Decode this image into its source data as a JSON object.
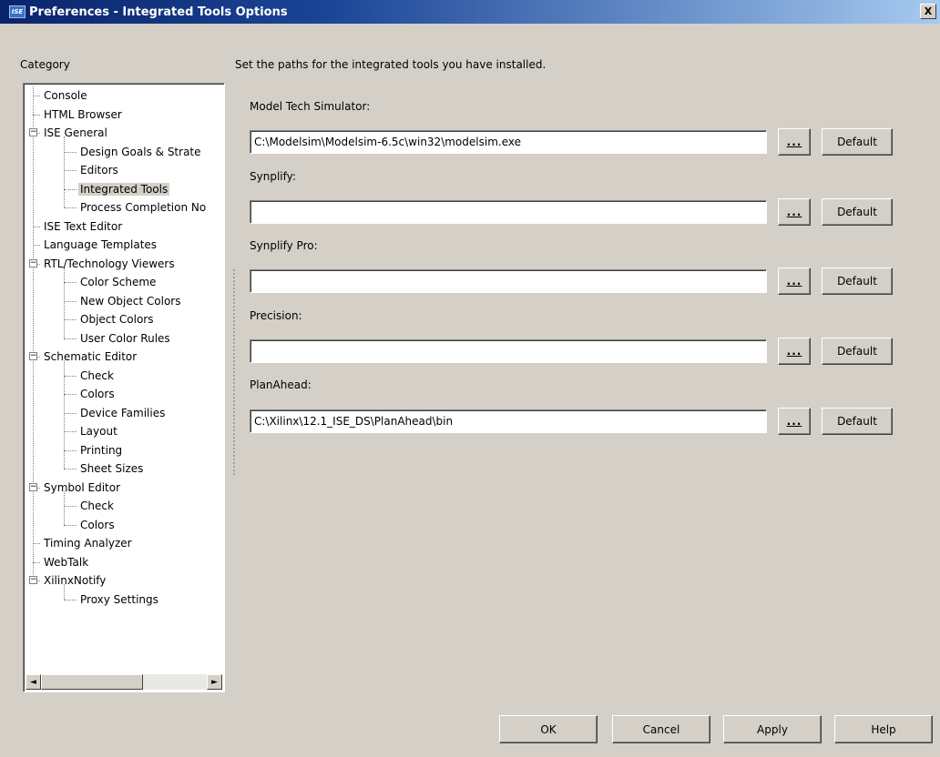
{
  "window": {
    "title": "Preferences - Integrated Tools Options",
    "icon_text": "ISE",
    "close_label": "X"
  },
  "category_label": "Category",
  "tree": {
    "items": [
      {
        "label": "Console",
        "level": 1
      },
      {
        "label": "HTML Browser",
        "level": 1
      },
      {
        "label": "ISE General",
        "level": 1,
        "expander": "−"
      },
      {
        "label": "Design Goals & Strate",
        "level": 2
      },
      {
        "label": "Editors",
        "level": 2
      },
      {
        "label": "Integrated Tools",
        "level": 2,
        "selected": true
      },
      {
        "label": "Process Completion No",
        "level": 2
      },
      {
        "label": "ISE Text Editor",
        "level": 1
      },
      {
        "label": "Language Templates",
        "level": 1
      },
      {
        "label": "RTL/Technology Viewers",
        "level": 1,
        "expander": "−"
      },
      {
        "label": "Color Scheme",
        "level": 2
      },
      {
        "label": "New Object Colors",
        "level": 2
      },
      {
        "label": "Object Colors",
        "level": 2
      },
      {
        "label": "User Color Rules",
        "level": 2
      },
      {
        "label": "Schematic Editor",
        "level": 1,
        "expander": "−"
      },
      {
        "label": "Check",
        "level": 2
      },
      {
        "label": "Colors",
        "level": 2
      },
      {
        "label": "Device Families",
        "level": 2
      },
      {
        "label": "Layout",
        "level": 2
      },
      {
        "label": "Printing",
        "level": 2
      },
      {
        "label": "Sheet Sizes",
        "level": 2
      },
      {
        "label": "Symbol Editor",
        "level": 1,
        "expander": "−"
      },
      {
        "label": "Check",
        "level": 2
      },
      {
        "label": "Colors",
        "level": 2
      },
      {
        "label": "Timing Analyzer",
        "level": 1
      },
      {
        "label": "WebTalk",
        "level": 1
      },
      {
        "label": "XilinxNotify",
        "level": 1,
        "expander": "−"
      },
      {
        "label": "Proxy Settings",
        "level": 2
      }
    ],
    "scroll_left": "◄",
    "scroll_right": "►"
  },
  "description": "Set the paths for the integrated tools you have installed.",
  "tools": [
    {
      "label": "Model Tech Simulator:",
      "value": "C:\\Modelsim\\Modelsim-6.5c\\win32\\modelsim.exe",
      "browse_label": "...",
      "default_label": "Default"
    },
    {
      "label": "Synplify:",
      "value": "",
      "browse_label": "...",
      "default_label": "Default"
    },
    {
      "label": "Synplify Pro:",
      "value": "",
      "browse_label": "...",
      "default_label": "Default"
    },
    {
      "label": "Precision:",
      "value": "",
      "browse_label": "...",
      "default_label": "Default"
    },
    {
      "label": "PlanAhead:",
      "value": "C:\\Xilinx\\12.1_ISE_DS\\PlanAhead\\bin",
      "browse_label": "...",
      "default_label": "Default"
    }
  ],
  "buttons": {
    "ok": "OK",
    "cancel": "Cancel",
    "apply": "Apply",
    "help": "Help"
  },
  "colors": {
    "dialog_background": "#d4d0c8",
    "titlebar_start": "#0a246a",
    "titlebar_end": "#a6caf0"
  }
}
